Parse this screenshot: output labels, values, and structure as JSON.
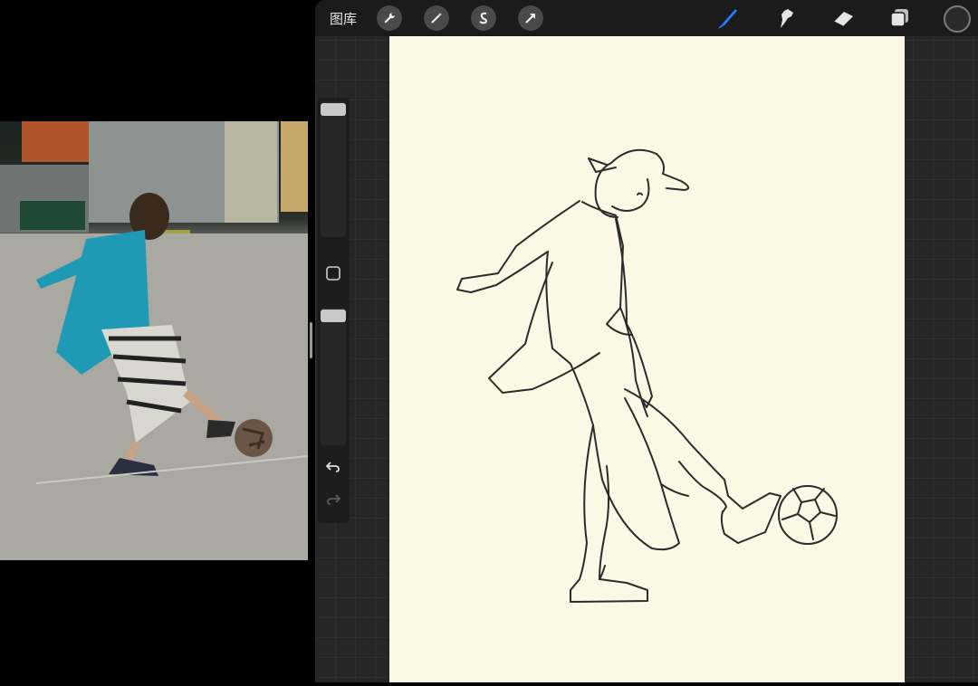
{
  "toolbar": {
    "gallery_label": "图库",
    "tools_left": [
      "wrench-icon",
      "magic-wand-icon",
      "selection-s-icon",
      "transform-arrow-icon"
    ],
    "tools_right": [
      "brush-icon",
      "smudge-icon",
      "eraser-icon",
      "layers-icon"
    ],
    "active_tool": "brush-icon",
    "accent_color": "#1e7cff",
    "current_color": "#2a2a2a"
  },
  "sidebar": {
    "controls": [
      "brush-size-slider",
      "modify-square-button",
      "opacity-slider",
      "undo-button",
      "redo-button"
    ]
  },
  "reference": {
    "subject": "photo"
  },
  "canvas": {
    "background": "#fdf7e6"
  }
}
